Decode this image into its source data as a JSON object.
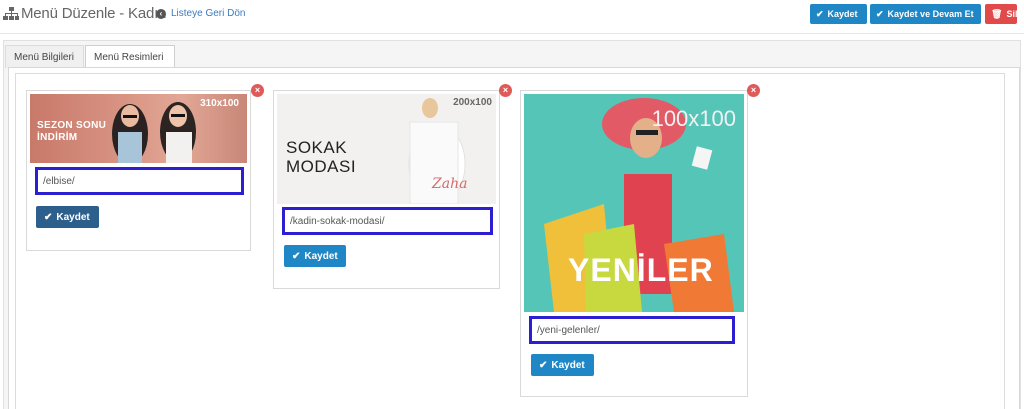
{
  "header": {
    "title": "Menü Düzenle - Kadın",
    "back_link": "Listeye Geri Dön",
    "buttons": {
      "save": "Kaydet",
      "save_continue": "Kaydet ve Devam Et",
      "delete": "Sil"
    }
  },
  "tabs": [
    {
      "label": "Menü Bilgileri",
      "active": false
    },
    {
      "label": "Menü Resimleri",
      "active": true
    }
  ],
  "cards": [
    {
      "size_label": "310x100",
      "banner_text": "SEZON SONU\nİNDİRİM",
      "url_value": "/elbise/",
      "save_label": "Kaydet"
    },
    {
      "size_label": "200x100",
      "banner_text": "SOKAK\nMODASI",
      "url_value": "/kadin-sokak-modasi/",
      "save_label": "Kaydet"
    },
    {
      "size_label": "100x100",
      "banner_text": "YENİLER",
      "url_value": "/yeni-gelenler/",
      "save_label": "Kaydet"
    }
  ],
  "colors": {
    "primary": "#1f87c5",
    "danger": "#e04a4a",
    "highlight": "#2b1fd1",
    "dark_button": "#2d5f8c"
  }
}
